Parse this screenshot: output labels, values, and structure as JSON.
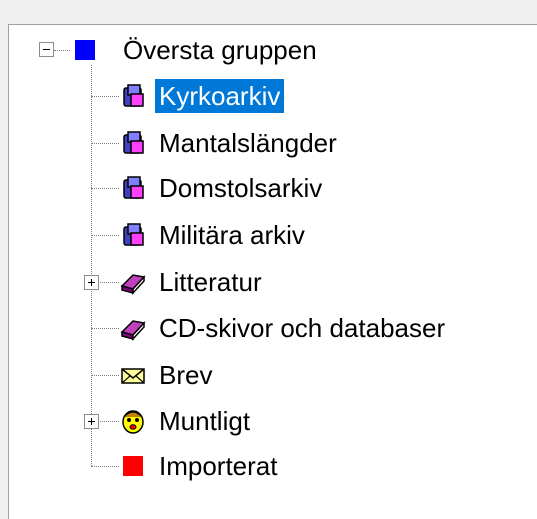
{
  "tree": {
    "root": {
      "label": "Översta gruppen",
      "icon": "blue-square-icon",
      "expanded": true
    },
    "items": [
      {
        "label": "Kyrkoarkiv",
        "icon": "archive-icon",
        "selected": true,
        "expander": "none"
      },
      {
        "label": "Mantalslängder",
        "icon": "archive-icon",
        "selected": false,
        "expander": "none"
      },
      {
        "label": "Domstolsarkiv",
        "icon": "archive-icon",
        "selected": false,
        "expander": "none"
      },
      {
        "label": "Militära arkiv",
        "icon": "archive-icon",
        "selected": false,
        "expander": "none"
      },
      {
        "label": "Litteratur",
        "icon": "book-icon",
        "selected": false,
        "expander": "plus"
      },
      {
        "label": "CD-skivor och databaser",
        "icon": "book-icon",
        "selected": false,
        "expander": "none"
      },
      {
        "label": "Brev",
        "icon": "envelope-icon",
        "selected": false,
        "expander": "none"
      },
      {
        "label": "Muntligt",
        "icon": "smiley-face-icon",
        "selected": false,
        "expander": "plus"
      },
      {
        "label": "Importerat",
        "icon": "red-square-icon",
        "selected": false,
        "expander": "none"
      }
    ]
  },
  "colors": {
    "selection": "#0078d7",
    "root_square": "#0000ff",
    "imported_square": "#ff0000"
  }
}
